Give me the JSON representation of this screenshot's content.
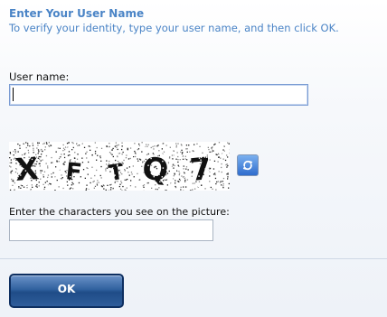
{
  "form": {
    "title": "Enter Your User Name",
    "instructions": "To verify your identity, type your user name, and then click OK.",
    "username_label": "User name:",
    "username_value": "",
    "captcha_text": "XFTQ7",
    "refresh_icon": "refresh-icon",
    "captcha_label": "Enter the characters you see on the picture:",
    "captcha_value": "",
    "ok_label": "OK"
  },
  "colors": {
    "heading": "#4a84c6",
    "button_dark": "#1f4c87",
    "input_focus_border": "#7a9cd3"
  }
}
